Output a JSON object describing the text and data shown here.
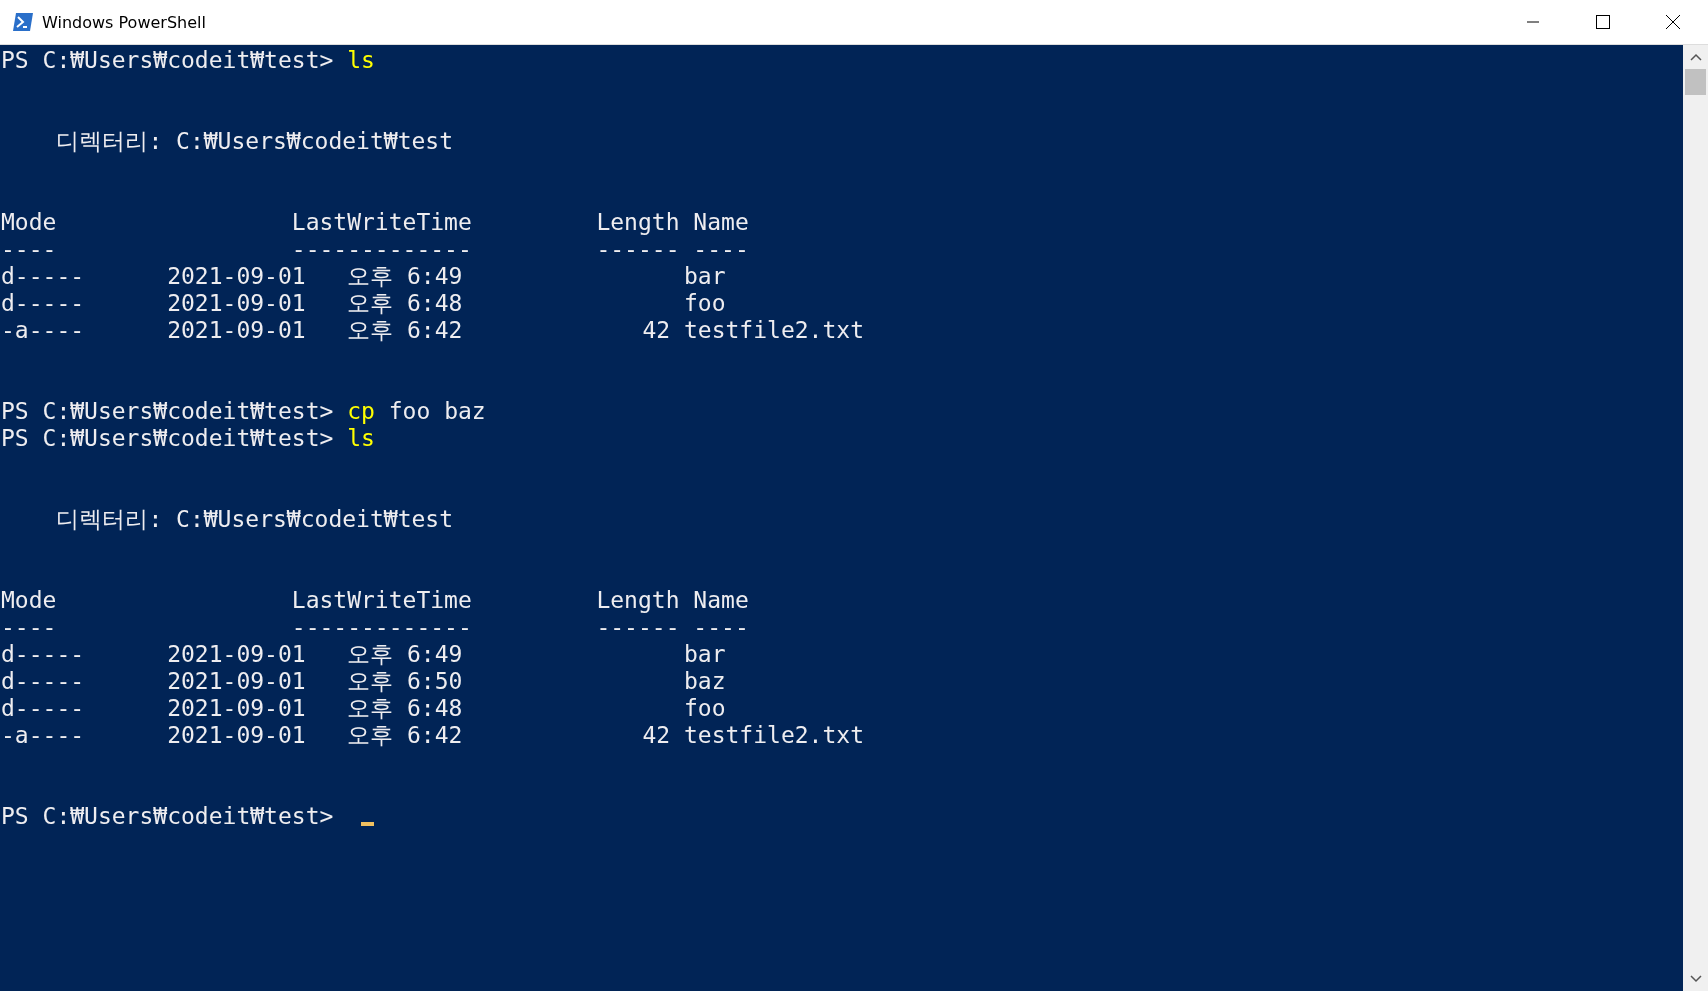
{
  "window": {
    "title": "Windows PowerShell"
  },
  "console": {
    "lines": [
      {
        "kind": "prompt",
        "prompt": "PS C:₩Users₩codeit₩test> ",
        "command": "ls"
      },
      {
        "kind": "blank"
      },
      {
        "kind": "blank"
      },
      {
        "kind": "output",
        "text": "    디렉터리: C:₩Users₩codeit₩test"
      },
      {
        "kind": "blank"
      },
      {
        "kind": "blank"
      },
      {
        "kind": "output",
        "text": "Mode                 LastWriteTime         Length Name"
      },
      {
        "kind": "output",
        "text": "----                 -------------         ------ ----"
      },
      {
        "kind": "output",
        "text": "d-----      2021-09-01   오후 6:49                bar"
      },
      {
        "kind": "output",
        "text": "d-----      2021-09-01   오후 6:48                foo"
      },
      {
        "kind": "output",
        "text": "-a----      2021-09-01   오후 6:42             42 testfile2.txt"
      },
      {
        "kind": "blank"
      },
      {
        "kind": "blank"
      },
      {
        "kind": "prompt",
        "prompt": "PS C:₩Users₩codeit₩test> ",
        "command": "cp",
        "args": " foo baz"
      },
      {
        "kind": "prompt",
        "prompt": "PS C:₩Users₩codeit₩test> ",
        "command": "ls"
      },
      {
        "kind": "blank"
      },
      {
        "kind": "blank"
      },
      {
        "kind": "output",
        "text": "    디렉터리: C:₩Users₩codeit₩test"
      },
      {
        "kind": "blank"
      },
      {
        "kind": "blank"
      },
      {
        "kind": "output",
        "text": "Mode                 LastWriteTime         Length Name"
      },
      {
        "kind": "output",
        "text": "----                 -------------         ------ ----"
      },
      {
        "kind": "output",
        "text": "d-----      2021-09-01   오후 6:49                bar"
      },
      {
        "kind": "output",
        "text": "d-----      2021-09-01   오후 6:50                baz"
      },
      {
        "kind": "output",
        "text": "d-----      2021-09-01   오후 6:48                foo"
      },
      {
        "kind": "output",
        "text": "-a----      2021-09-01   오후 6:42             42 testfile2.txt"
      },
      {
        "kind": "blank"
      },
      {
        "kind": "blank"
      },
      {
        "kind": "prompt",
        "prompt": "PS C:₩Users₩codeit₩test> ",
        "cursor": true
      }
    ]
  }
}
